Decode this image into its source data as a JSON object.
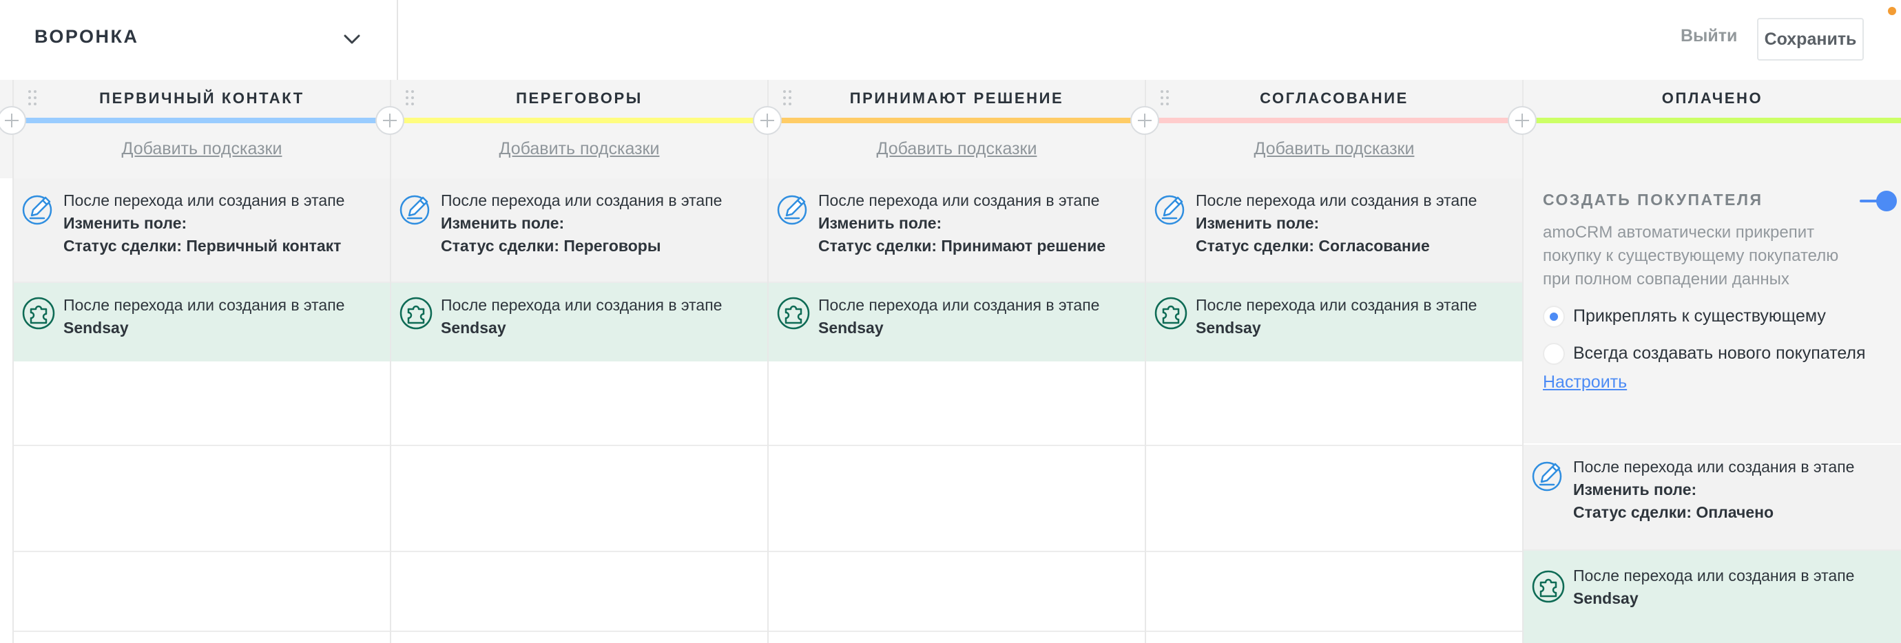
{
  "header": {
    "pipeline_title": "ВОРОНКА",
    "exit_label": "Выйти",
    "save_label": "Сохранить"
  },
  "add_hints_label": "Добавить подсказки",
  "stages": [
    {
      "title": "ПЕРВИЧНЫЙ КОНТАКТ",
      "color": "#99ccff",
      "trigger_change": {
        "when": "После перехода или создания в этапе",
        "action": "Изменить поле:",
        "detail": "Статус сделки: Первичный контакт"
      },
      "trigger_sendsay": {
        "when": "После перехода или создания в этапе",
        "name": "Sendsay"
      }
    },
    {
      "title": "ПЕРЕГОВОРЫ",
      "color": "#fffd7f",
      "trigger_change": {
        "when": "После перехода или создания в этапе",
        "action": "Изменить поле:",
        "detail": "Статус сделки: Переговоры"
      },
      "trigger_sendsay": {
        "when": "После перехода или создания в этапе",
        "name": "Sendsay"
      }
    },
    {
      "title": "ПРИНИМАЮТ РЕШЕНИЕ",
      "color": "#ffcc66",
      "trigger_change": {
        "when": "После перехода или создания в этапе",
        "action": "Изменить поле:",
        "detail": "Статус сделки: Принимают решение"
      },
      "trigger_sendsay": {
        "when": "После перехода или создания в этапе",
        "name": "Sendsay"
      }
    },
    {
      "title": "СОГЛАСОВАНИЕ",
      "color": "#ffcccc",
      "trigger_change": {
        "when": "После перехода или создания в этапе",
        "action": "Изменить поле:",
        "detail": "Статус сделки: Согласование"
      },
      "trigger_sendsay": {
        "when": "После перехода или создания в этапе",
        "name": "Sendsay"
      }
    },
    {
      "title": "ОПЛАЧЕНО",
      "color": "#ccff66",
      "trigger_change": {
        "when": "После перехода или создания в этапе",
        "action": "Изменить поле:",
        "detail": "Статус сделки: Оплачено"
      },
      "trigger_sendsay": {
        "when": "После перехода или создания в этапе",
        "name": "Sendsay"
      }
    }
  ],
  "buyer": {
    "title": "СОЗДАТЬ ПОКУПАТЕЛЯ",
    "enabled": true,
    "description": "amoCRM автоматически прикрепит покупку к существующему покупателю при полном совпадении данных",
    "option_attach": "Прикреплять к существующему",
    "option_new": "Всегда создавать нового покупателя",
    "selected": "attach",
    "configure_label": "Настроить"
  },
  "colors": {
    "accent": "#4c8bf5",
    "sendsay_bg": "#e2f1ea",
    "edit_icon": "#2f8ee0",
    "sendsay_icon": "#0e6b55"
  },
  "icons": {
    "dropdown": "chevron-down-icon",
    "edit_trigger": "edit-pencil-icon",
    "sendsay_trigger": "puzzle-icon",
    "drag": "drag-handle-icon",
    "add_stage": "plus-icon"
  }
}
